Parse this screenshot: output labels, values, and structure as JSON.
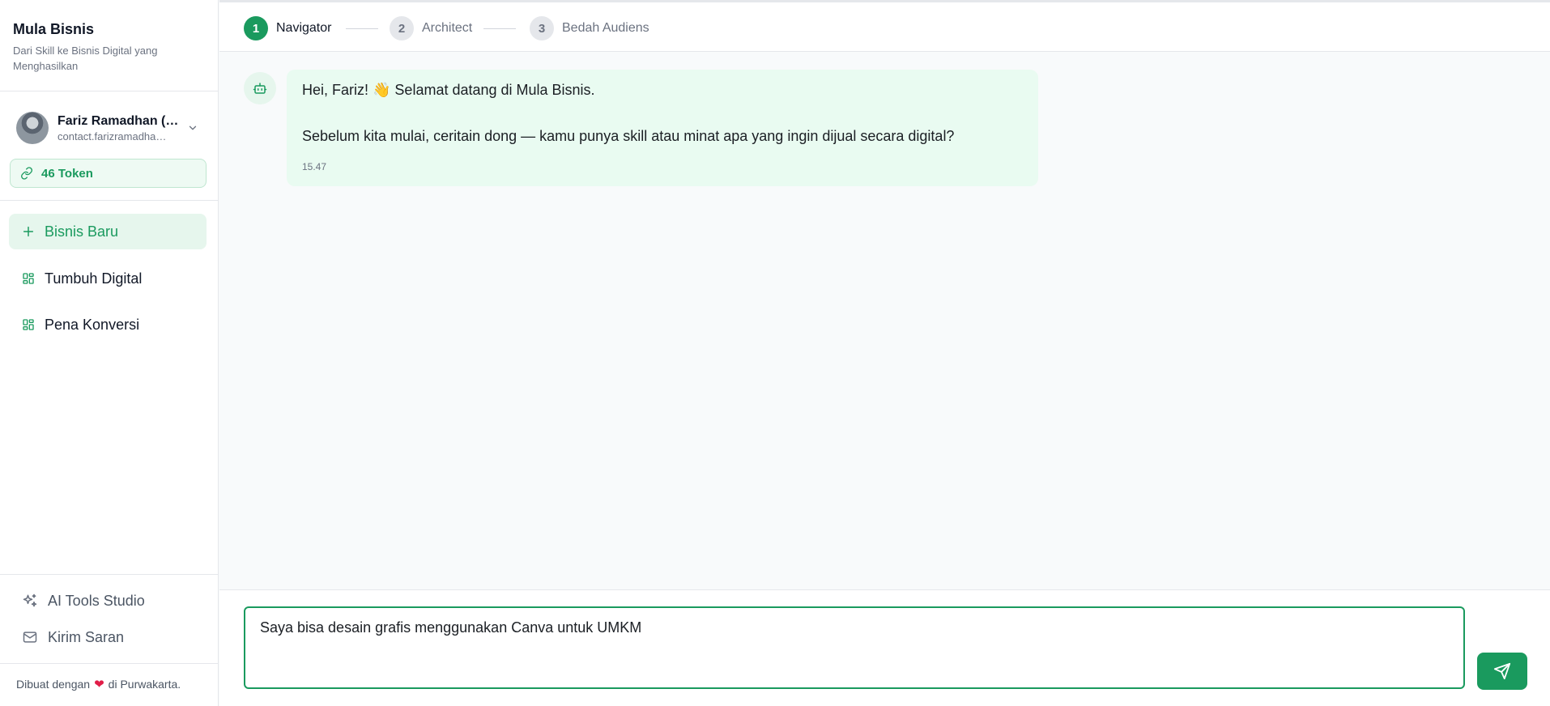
{
  "brand": {
    "title": "Mula Bisnis",
    "tagline": "Dari Skill ke Bisnis Digital yang Menghasilkan"
  },
  "user": {
    "name": "Fariz Ramadhan (…",
    "email": "contact.farizramadha…"
  },
  "tokens": {
    "label": "46 Token"
  },
  "nav": {
    "items": [
      {
        "label": "Bisnis Baru",
        "icon": "plus-icon",
        "active": true
      },
      {
        "label": "Tumbuh Digital",
        "icon": "grid-icon",
        "active": false
      },
      {
        "label": "Pena Konversi",
        "icon": "grid-icon",
        "active": false
      }
    ]
  },
  "footer_nav": {
    "items": [
      {
        "label": "AI Tools Studio",
        "icon": "sparkles-icon"
      },
      {
        "label": "Kirim Saran",
        "icon": "mail-icon"
      }
    ],
    "credit_prefix": "Dibuat dengan",
    "credit_heart": "❤",
    "credit_suffix": "di Purwakarta."
  },
  "steps": [
    {
      "number": "1",
      "label": "Navigator",
      "active": true
    },
    {
      "number": "2",
      "label": "Architect",
      "active": false
    },
    {
      "number": "3",
      "label": "Bedah Audiens",
      "active": false
    }
  ],
  "chat": {
    "messages": [
      {
        "sender": "bot",
        "line1": "Hei, Fariz! 👋 Selamat datang di Mula Bisnis.",
        "line2": "Sebelum kita mulai, ceritain dong — kamu punya skill atau minat apa yang ingin dijual secara digital?",
        "time": "15.47"
      }
    ]
  },
  "composer": {
    "value": "Saya bisa desain grafis menggunakan Canva untuk UMKM",
    "send_icon": "send-icon"
  },
  "colors": {
    "accent": "#1a9a5e",
    "accent_light": "#e6f6ed",
    "bubble": "#e9fbf1",
    "heart": "#e11d48"
  }
}
